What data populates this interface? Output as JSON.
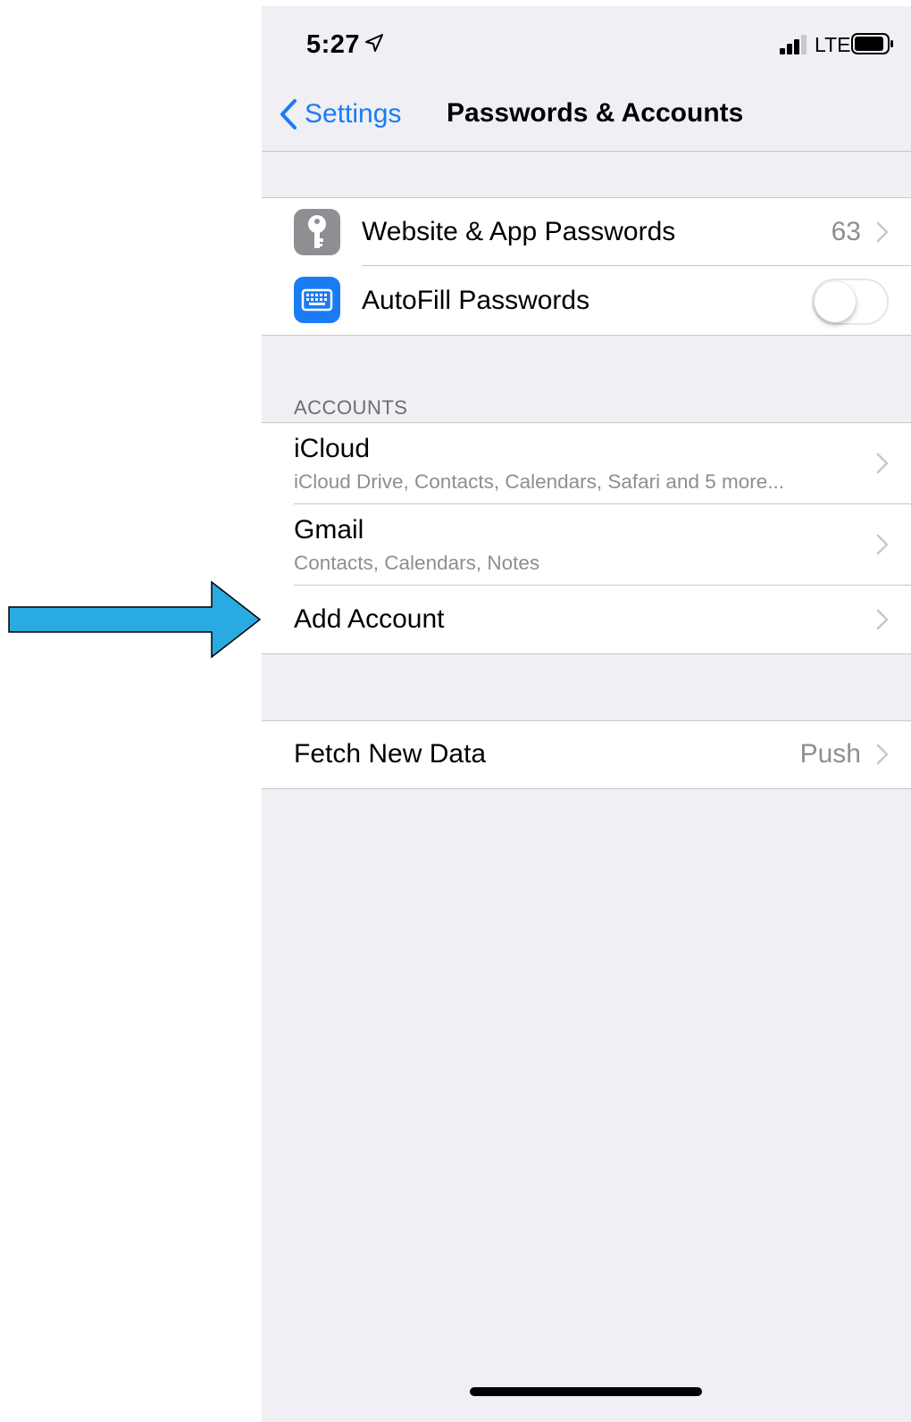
{
  "status_bar": {
    "time": "5:27",
    "network": "LTE"
  },
  "nav": {
    "back_label": "Settings",
    "title": "Passwords & Accounts"
  },
  "passwords_group": {
    "website_passwords": {
      "label": "Website & App Passwords",
      "value": "63",
      "icon": "key-icon"
    },
    "autofill": {
      "label": "AutoFill Passwords",
      "icon": "keyboard-icon",
      "enabled": false
    }
  },
  "accounts": {
    "header": "ACCOUNTS",
    "icloud": {
      "title": "iCloud",
      "subtitle": "iCloud Drive, Contacts, Calendars, Safari and 5 more..."
    },
    "gmail": {
      "title": "Gmail",
      "subtitle": "Contacts, Calendars, Notes"
    },
    "add_account": "Add Account"
  },
  "fetch": {
    "label": "Fetch New Data",
    "value": "Push"
  },
  "colors": {
    "accent": "#1a7cf5",
    "arrow": "#29abe2",
    "key_icon_bg": "#8e8e93",
    "keyboard_icon_bg": "#1a7cf5",
    "background": "#efeff4"
  }
}
